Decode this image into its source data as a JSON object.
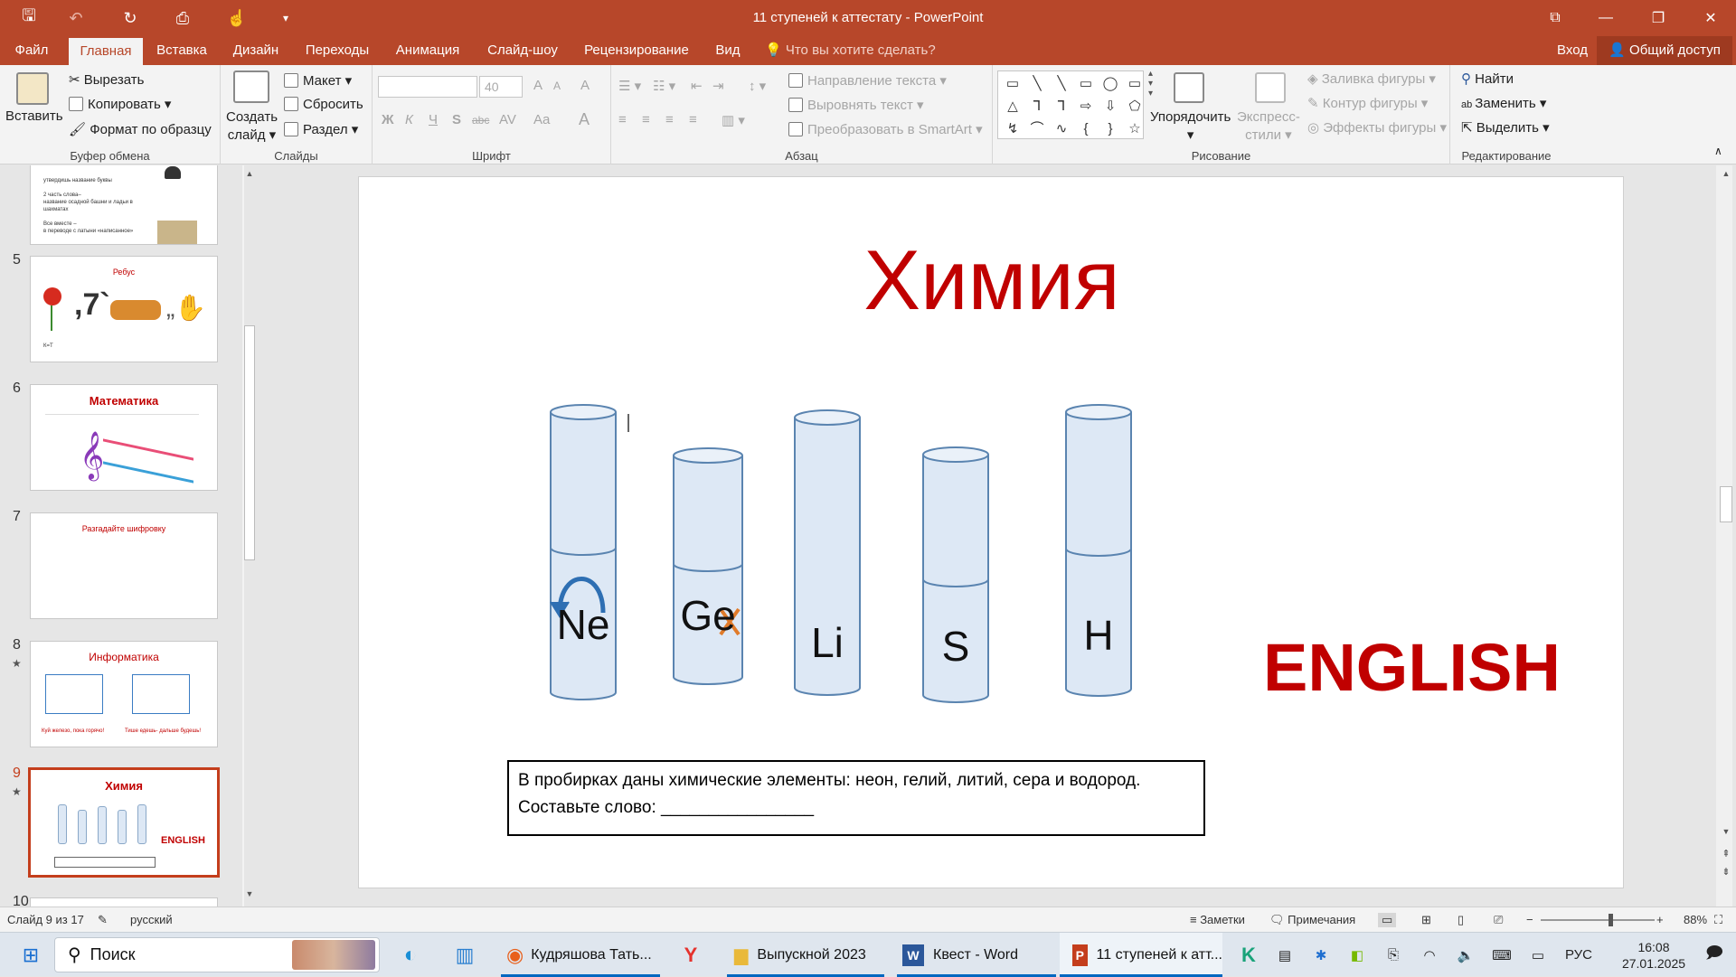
{
  "window": {
    "title": "11 ступеней к аттестату - PowerPoint",
    "controls": [
      "⧉",
      "—",
      "❐",
      "✕"
    ]
  },
  "qat": {
    "save": "🖫",
    "undo": "↶",
    "redo": "↻",
    "present": "⎙",
    "touch": "☝",
    "more": "▾"
  },
  "tabs": [
    "Файл",
    "Главная",
    "Вставка",
    "Дизайн",
    "Переходы",
    "Анимация",
    "Слайд-шоу",
    "Рецензирование",
    "Вид"
  ],
  "tell_me": "Что вы хотите сделать?",
  "signin": "Вход",
  "share": "Общий доступ",
  "ribbon": {
    "clipboard": {
      "label": "Буфер обмена",
      "paste": "Вставить",
      "cut": "Вырезать",
      "copy": "Копировать",
      "format_painter": "Формат по образцу"
    },
    "slides": {
      "label": "Слайды",
      "new_slide_1": "Создать",
      "new_slide_2": "слайд",
      "layout": "Макет",
      "reset": "Сбросить",
      "section": "Раздел"
    },
    "font": {
      "label": "Шрифт",
      "font_name": "",
      "font_size": "40",
      "bold": "Ж",
      "italic": "К",
      "underline": "Ч",
      "shadow": "S",
      "strike": "abc",
      "spacing": "AV",
      "case": "Aa",
      "color": "A",
      "grow": "A",
      "shrink": "A",
      "clear": "A"
    },
    "paragraph": {
      "label": "Абзац",
      "text_direction": "Направление текста",
      "align_text": "Выровнять текст",
      "smartart": "Преобразовать в SmartArt"
    },
    "drawing": {
      "label": "Рисование",
      "arrange": "Упорядочить",
      "quick_styles_1": "Экспресс-",
      "quick_styles_2": "стили",
      "shape_fill": "Заливка фигуры",
      "shape_outline": "Контур фигуры",
      "shape_effects": "Эффекты фигуры",
      "shapes": [
        "▭",
        "╲",
        "╲",
        "▭",
        "◯",
        "▭",
        "△",
        "⅂",
        "⅂",
        "⇨",
        "⇩",
        "⬠",
        "↯",
        "⌒",
        "∿",
        "{",
        "}",
        "☆"
      ]
    },
    "editing": {
      "label": "Редактирование",
      "find": "Найти",
      "replace": "Заменить",
      "select": "Выделить"
    }
  },
  "thumbnails": [
    {
      "num": "5",
      "title": "Ребус",
      "note": "К=Т",
      "star": false
    },
    {
      "num": "6",
      "title": "Математика",
      "note": "",
      "star": false
    },
    {
      "num": "7",
      "title": "Разгадайте шифровку",
      "note": "",
      "star": false
    },
    {
      "num": "8",
      "title": "Информатика",
      "note": "",
      "star": true
    },
    {
      "num": "9",
      "title": "Химия",
      "note": "ENGLISH",
      "star": true
    },
    {
      "num": "10",
      "title": "",
      "note": "",
      "star": false
    }
  ],
  "thumb_top_text": [
    "утвердишь название буквы",
    "2 часть слова–",
    "название осадной башни и ладьи в",
    "шахматах",
    "Все вместе –",
    "в переводе с латыни «написанное»"
  ],
  "thumb_informatika_notes": [
    "Куй железо, пока горячо!",
    "Тише едешь- дальше будешь!"
  ],
  "slide": {
    "title": "Химия",
    "tubes": [
      "Ne",
      "Ge",
      "Li",
      "S",
      "H"
    ],
    "side_word": "ENGLISH",
    "textbox_line1": "В пробирках даны химические элементы: неон, гелий, литий, сера и водород.",
    "textbox_line2": "Составьте слово: ________________"
  },
  "status": {
    "slide_counter": "Слайд 9 из 17",
    "language": "русский",
    "notes": "Заметки",
    "comments": "Примечания",
    "zoom": "88%",
    "zoom_fraction": 0.62
  },
  "taskbar": {
    "search": "Поиск",
    "items": [
      "Кудряшова Тать...",
      "Выпускной 2023",
      "Квест - Word",
      "11 ступеней к атт..."
    ],
    "lang": "РУС",
    "time": "16:08",
    "date": "27.01.2025"
  },
  "colors": {
    "accent": "#b7472a",
    "title_red": "#c00000",
    "tube_fill": "#dde8f5",
    "tube_stroke": "#5a84b0"
  }
}
